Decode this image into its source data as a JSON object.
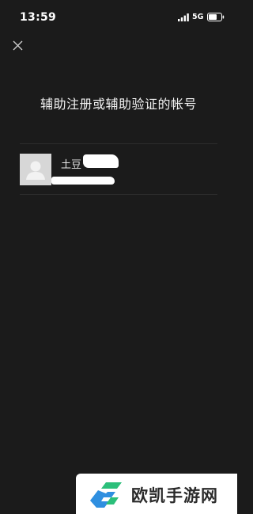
{
  "status_bar": {
    "time": "13:59",
    "network": "5G",
    "icons": [
      "signal-icon",
      "battery-icon"
    ]
  },
  "header": {
    "close_icon": "close-icon",
    "title": "辅助注册或辅助验证的帐号"
  },
  "accounts": [
    {
      "name": "土豆",
      "avatar_icon": "default-avatar-icon"
    }
  ],
  "watermark": {
    "text": "欧凯手游网"
  },
  "colors": {
    "background": "#1b1b1b",
    "divider": "#2c2c2c",
    "avatar_bg": "#d7d7d7",
    "text": "#f2f2f2",
    "logo_green": "#2bbf7a",
    "logo_blue": "#2f8fe0"
  }
}
